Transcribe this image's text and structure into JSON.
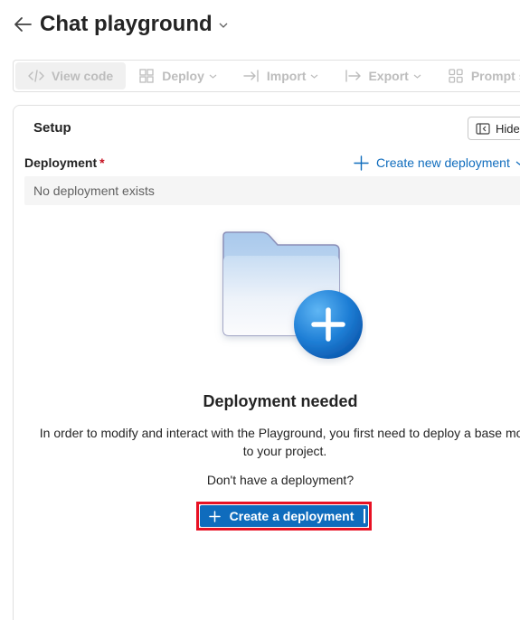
{
  "header": {
    "title": "Chat playground",
    "back_icon": "arrow-left-icon",
    "title_menu_icon": "chevron-down-icon"
  },
  "toolbar": {
    "items": [
      {
        "label": "View code",
        "icon": "code-icon"
      },
      {
        "label": "Deploy",
        "icon": "deploy-icon"
      },
      {
        "label": "Import",
        "icon": "import-icon"
      },
      {
        "label": "Export",
        "icon": "export-icon"
      },
      {
        "label": "Prompt sa",
        "icon": "prompt-samples-icon"
      }
    ]
  },
  "setup": {
    "title": "Setup",
    "hide_label": "Hide",
    "deployment_label": "Deployment",
    "required_marker": "*",
    "create_new_label": "Create new deployment",
    "select_value": "No deployment exists"
  },
  "empty_state": {
    "title": "Deployment needed",
    "description_line1": "In order to modify and interact with the Playground, you first need to deploy a base mod",
    "description_line2": "to your project.",
    "prompt": "Don't have a deployment?",
    "button_label": "Create a deployment"
  },
  "colors": {
    "accent": "#0f6cbd",
    "highlight_outline": "#e81123",
    "required": "#c50f1f"
  }
}
